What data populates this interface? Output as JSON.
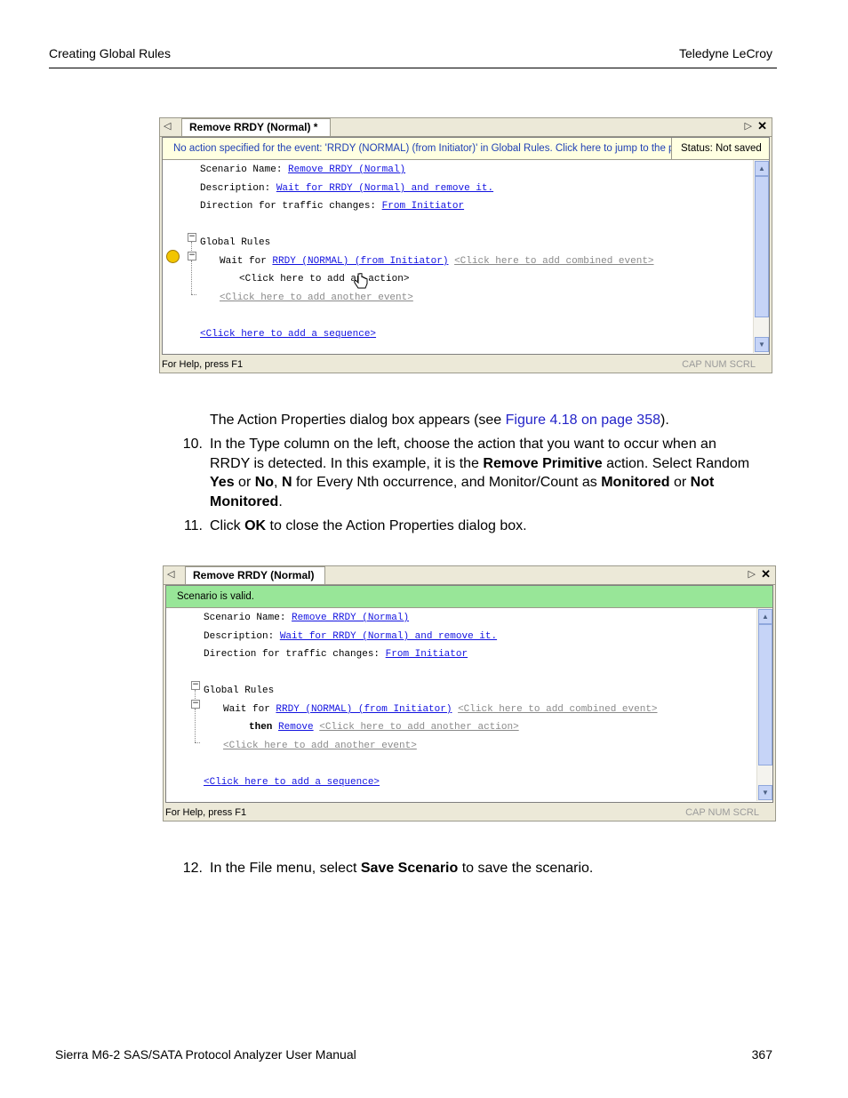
{
  "header": {
    "left": "Creating Global Rules",
    "right": "Teledyne  LeCroy"
  },
  "footer": {
    "left": "Sierra M6-2 SAS/SATA Protocol Analyzer User Manual",
    "right": "367"
  },
  "figure1": {
    "tab_label": "Remove RRDY (Normal) *",
    "message": "No action specified for the event: 'RRDY (NORMAL) (from Initiator)' in Global Rules.  Click here to jump to the p...",
    "status": "Status: Not saved",
    "scenario_name_label": "Scenario Name:",
    "scenario_name_value": "Remove RRDY (Normal)",
    "description_label": "Description:",
    "description_value": "Wait for RRDY (Normal) and remove it.",
    "direction_label": "Direction for traffic changes:",
    "direction_value": "From Initiator",
    "global_rules": "Global Rules",
    "wait_for": "Wait for",
    "event": "RRDY (NORMAL) (from Initiator)",
    "add_combined": "<Click here to add combined event>",
    "add_action": "<Click here to add an action>",
    "add_another_event": "<Click here to add another event>",
    "add_sequence": "<Click here to add a sequence>",
    "help": "For Help, press F1",
    "indicators": "CAP  NUM  SCRL"
  },
  "step_text": {
    "intro_prefix": "The Action Properties dialog box appears (see ",
    "intro_link": "Figure 4.18 on page 358",
    "intro_suffix": ").",
    "step10_num": "10.",
    "step10_a": "In the Type column on the left, choose the action that you want to occur when an",
    "step10_b1": "RRDY is detected. In this example, it is the ",
    "step10_b2": "Remove Primitive",
    "step10_b3": " action. Select Random",
    "step10_c1": "Yes",
    "step10_c2": " or ",
    "step10_c3": "No",
    "step10_c4": ", ",
    "step10_c5": "N",
    "step10_c6": " for Every Nth occurrence, and Monitor/Count as ",
    "step10_c7": "Monitored",
    "step10_c8": " or ",
    "step10_c9": "Not",
    "step10_d1": "Monitored",
    "step10_d2": ".",
    "step11_num": "11.",
    "step11_a": "Click ",
    "step11_b": "OK",
    "step11_c": " to close the Action Properties dialog box.",
    "step12_num": "12.",
    "step12_a": "In the File menu, select ",
    "step12_b": "Save Scenario",
    "step12_c": " to save the scenario."
  },
  "figure2": {
    "tab_label": "Remove RRDY (Normal)",
    "message": "Scenario is valid.",
    "scenario_name_label": "Scenario Name:",
    "scenario_name_value": "Remove RRDY (Normal)",
    "description_label": "Description:",
    "description_value": "Wait for RRDY (Normal) and remove it.",
    "direction_label": "Direction for traffic changes:",
    "direction_value": "From Initiator",
    "global_rules": "Global Rules",
    "wait_for": "Wait for",
    "event": "RRDY (NORMAL) (from Initiator)",
    "add_combined": "<Click here to add combined event>",
    "then": "then",
    "action": "Remove",
    "add_another_action": "<Click here to add another action>",
    "add_another_event": "<Click here to add another event>",
    "add_sequence": "<Click here to add a sequence>",
    "help": "For Help, press F1",
    "indicators": "CAP  NUM  SCRL"
  }
}
